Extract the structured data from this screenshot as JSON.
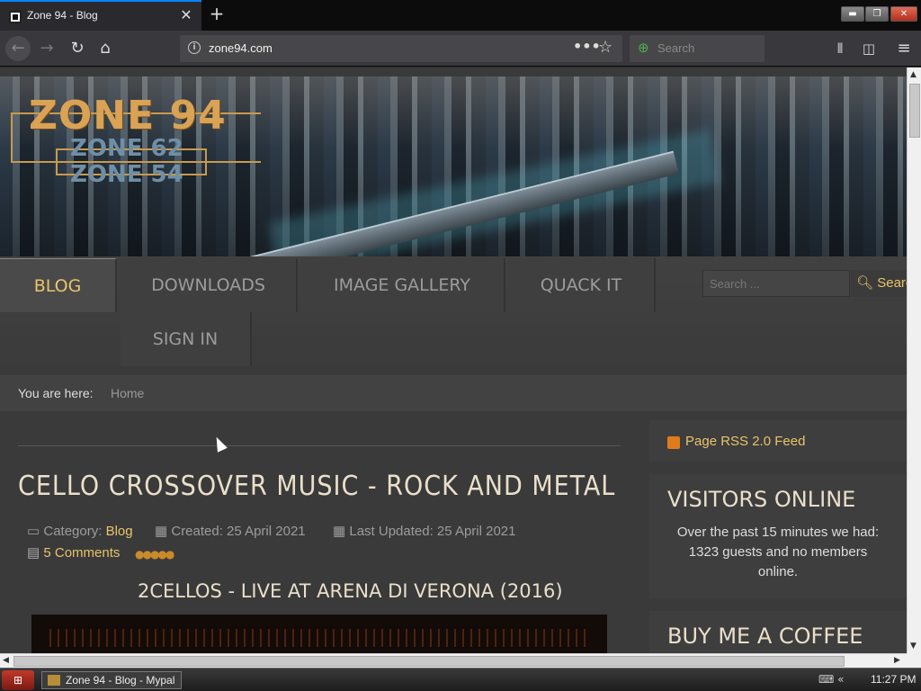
{
  "browser": {
    "tab_title": "Zone 94 - Blog",
    "close_tab": "✕",
    "new_tab": "+",
    "url": "zone94.com",
    "page_actions": "•••",
    "bookmark": "☆",
    "search_placeholder": "Search",
    "window_buttons": {
      "min": "▬",
      "max": "❐",
      "close": "✕"
    }
  },
  "site": {
    "logo_main": "ZONE 94",
    "logo_sub1": "ZONE 62",
    "logo_sub2": "ZONE 54",
    "nav": [
      "BLOG",
      "DOWNLOADS",
      "IMAGE GALLERY",
      "QUACK IT",
      "SIGN IN"
    ],
    "search_placeholder": "Search ...",
    "search_button": "Search",
    "breadcrumb_label": "You are here:",
    "breadcrumb_home": "Home"
  },
  "article": {
    "title": "CELLO CROSSOVER MUSIC - ROCK AND METAL",
    "category_label": "Category:",
    "category": "Blog",
    "created": "Created: 25 April 2021",
    "updated": "Last Updated: 25 April 2021",
    "comments": "5 Comments",
    "rating": "●●●●●",
    "subtitle": "2CELLOS - LIVE AT ARENA DI VERONA (2016)"
  },
  "sidebar": {
    "rss": "Page RSS 2.0 Feed",
    "visitors_title": "VISITORS ONLINE",
    "visitors_text": "Over the past 15 minutes we had: 1323 guests and no members online.",
    "coffee_title": "BUY ME A COFFEE"
  },
  "taskbar": {
    "app": "Zone 94 - Blog - Mypal",
    "tray": "⌨  «",
    "clock": "11:27 PM"
  }
}
